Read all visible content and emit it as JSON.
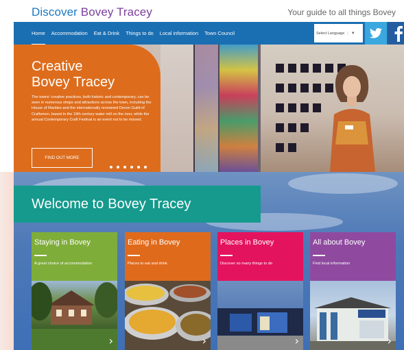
{
  "brand": {
    "part1": "Discover",
    "part2": "Bovey Tracey"
  },
  "tagline": "Your guide to all things Bovey",
  "nav": {
    "items": [
      "Home",
      "Accommodation",
      "Eat & Drink",
      "Things to do",
      "Local information",
      "Town Council"
    ],
    "language_label": "Select Language",
    "language_arrow": "▼",
    "twitter_icon": "twitter-bird-icon",
    "facebook_icon": "facebook-f-icon"
  },
  "hero": {
    "title_line1": "Creative",
    "title_line2": "Bovey Tracey",
    "body": "The towns' creative practices, both historic and contemporary, can be seen in numerous shops and attractions across the town, including the House of Marbles and the internationally renowned Devon Guild of Craftsmen, based in the 19th century water mill on the river, while the annual Contemporary Craft Festival is an event not to be missed.",
    "button": "FIND OUT MORE",
    "slide_count": 6
  },
  "welcome": {
    "text": "Welcome to",
    "bold": "Bovey Tracey"
  },
  "cards": [
    {
      "title": "Staying in",
      "bold": "Bovey",
      "sub": "A great choice of accommodation",
      "color": "#7fad3a",
      "chevron": "›"
    },
    {
      "title": "Eating in",
      "bold": "Bovey",
      "sub": "Places to eat and drink",
      "color": "#e06a1c",
      "chevron": "›"
    },
    {
      "title": "Places in",
      "bold": "Bovey",
      "sub": "Discover so many things to do",
      "color": "#e4135d",
      "chevron": "›"
    },
    {
      "title": "All about",
      "bold": "Bovey",
      "sub": "Find local information",
      "color": "#8f4aa0",
      "chevron": "›"
    }
  ]
}
